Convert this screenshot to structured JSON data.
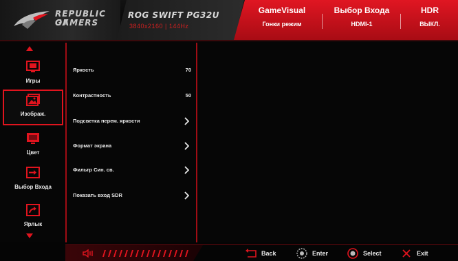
{
  "header": {
    "brand_line1": "REPUBLIC OF",
    "brand_line2": "GAMERS",
    "model_name": "ROG SWIFT PG32U",
    "model_resolution": "3840x2160 | 144Hz",
    "gamevisual": {
      "title": "GameVisual",
      "value": "Гонки режим"
    },
    "input_select": {
      "title": "Выбор Входа",
      "value": "HDMI-1"
    },
    "hdr": {
      "title": "HDR",
      "value": "ВЫКЛ."
    }
  },
  "nav": {
    "items": [
      {
        "label": "Игры",
        "icon": "gamepad-screen-icon"
      },
      {
        "label": "Изображ.",
        "icon": "image-icon",
        "active": true
      },
      {
        "label": "Цвет",
        "icon": "color-monitor-icon"
      },
      {
        "label": "Выбор Входа",
        "icon": "input-arrow-icon"
      },
      {
        "label": "Ярлык",
        "icon": "shortcut-icon"
      }
    ]
  },
  "menu": {
    "items": [
      {
        "label": "Яркость",
        "value": "70"
      },
      {
        "label": "Контрастность",
        "value": "50"
      },
      {
        "label": "Подсветка перем. яркости",
        "submenu": true
      },
      {
        "label": "Формат экрана",
        "submenu": true
      },
      {
        "label": "Фильтр Син. св.",
        "submenu": true
      },
      {
        "label": "Показать вход SDR",
        "submenu": true
      }
    ]
  },
  "footer": {
    "back": "Back",
    "enter": "Enter",
    "select": "Select",
    "exit": "Exit"
  },
  "colors": {
    "accent_red": "#e0141e",
    "background": "#060606"
  }
}
